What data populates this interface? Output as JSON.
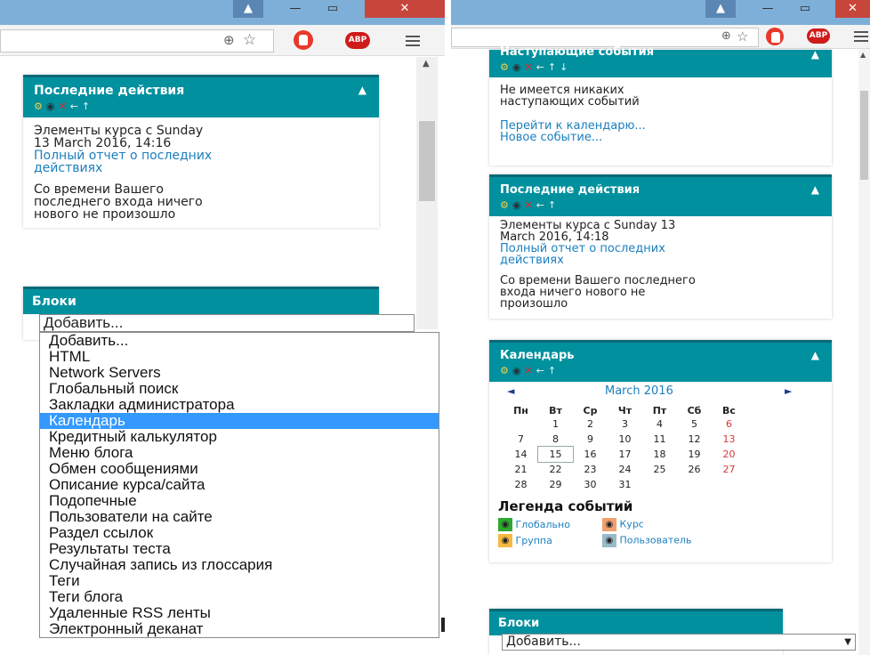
{
  "left": {
    "recent_block": {
      "title": "Последние действия",
      "collapse_glyph": "▲",
      "lines": [
        "Элементы курса с Sunday",
        "13 March 2016, 14:16"
      ],
      "report_link": [
        "Полный отчет о последних",
        "действиях"
      ],
      "nothing_new": [
        "Со времени Вашего",
        "последнего входа ничего",
        "нового не произошло"
      ]
    },
    "blocks_block": {
      "title": "Блоки",
      "select_value": "Добавить...",
      "options": [
        "Добавить...",
        "HTML",
        "Network Servers",
        "Глобальный поиск",
        "Закладки администратора",
        "Календарь",
        "Кредитный калькулятор",
        "Меню блога",
        "Обмен сообщениями",
        "Описание курса/сайта",
        "Подопечные",
        "Пользователи на сайте",
        "Раздел ссылок",
        "Результаты теста",
        "Случайная запись из глоссария",
        "Теги",
        "Теги блога",
        "Удаленные RSS ленты",
        "Электронный деканат"
      ],
      "selected_option": "Календарь"
    }
  },
  "right": {
    "upcoming_block": {
      "title": "Наступающие события",
      "collapse_glyph": "▲",
      "empty_text": [
        "Не имеется никаких",
        "наступающих событий"
      ],
      "goto_link": "Перейти к календарю...",
      "new_event_link": "Новое событие..."
    },
    "recent_block": {
      "title": "Последние действия",
      "collapse_glyph": "▲",
      "lines": [
        "Элементы курса с Sunday 13",
        "March 2016, 14:18"
      ],
      "report_link": [
        "Полный отчет о последних",
        "действиях"
      ],
      "nothing_new": [
        "Со времени Вашего последнего",
        "входа ничего нового не",
        "произошло"
      ]
    },
    "calendar_block": {
      "title": "Календарь",
      "collapse_glyph": "▲",
      "month": "March 2016",
      "prev_glyph": "◄",
      "next_glyph": "►",
      "weekdays": [
        "Пн",
        "Вт",
        "Ср",
        "Чт",
        "Пт",
        "Сб",
        "Вс"
      ],
      "weeks": [
        [
          "",
          "1",
          "2",
          "3",
          "4",
          "5",
          "6"
        ],
        [
          "7",
          "8",
          "9",
          "10",
          "11",
          "12",
          "13"
        ],
        [
          "14",
          "15",
          "16",
          "17",
          "18",
          "19",
          "20"
        ],
        [
          "21",
          "22",
          "23",
          "24",
          "25",
          "26",
          "27"
        ],
        [
          "28",
          "29",
          "30",
          "31",
          "",
          "",
          ""
        ]
      ],
      "today": "15",
      "legend_title": "Легенда событий",
      "legend": {
        "global": "Глобально",
        "course": "Курс",
        "group": "Группа",
        "user": "Пользователь"
      },
      "legend_colors": {
        "global": "#2fa82f",
        "course": "#f0a070",
        "group": "#f5b942",
        "user": "#9ab9c9"
      }
    },
    "blocks_block": {
      "title": "Блоки",
      "select_value": "Добавить..."
    }
  },
  "browser": {
    "minimize": "—",
    "restore": "▭",
    "close": "✕",
    "abp_label": "ABP",
    "zoom_icon": "⊕",
    "star_icon": "☆",
    "scroll_up": "▲",
    "dropdown_arrow": "▼"
  },
  "colors": {
    "block_header": "#00909e",
    "link": "#1b7fbe",
    "weekend": "#d63638",
    "dropdown_highlight": "#3399ff"
  }
}
